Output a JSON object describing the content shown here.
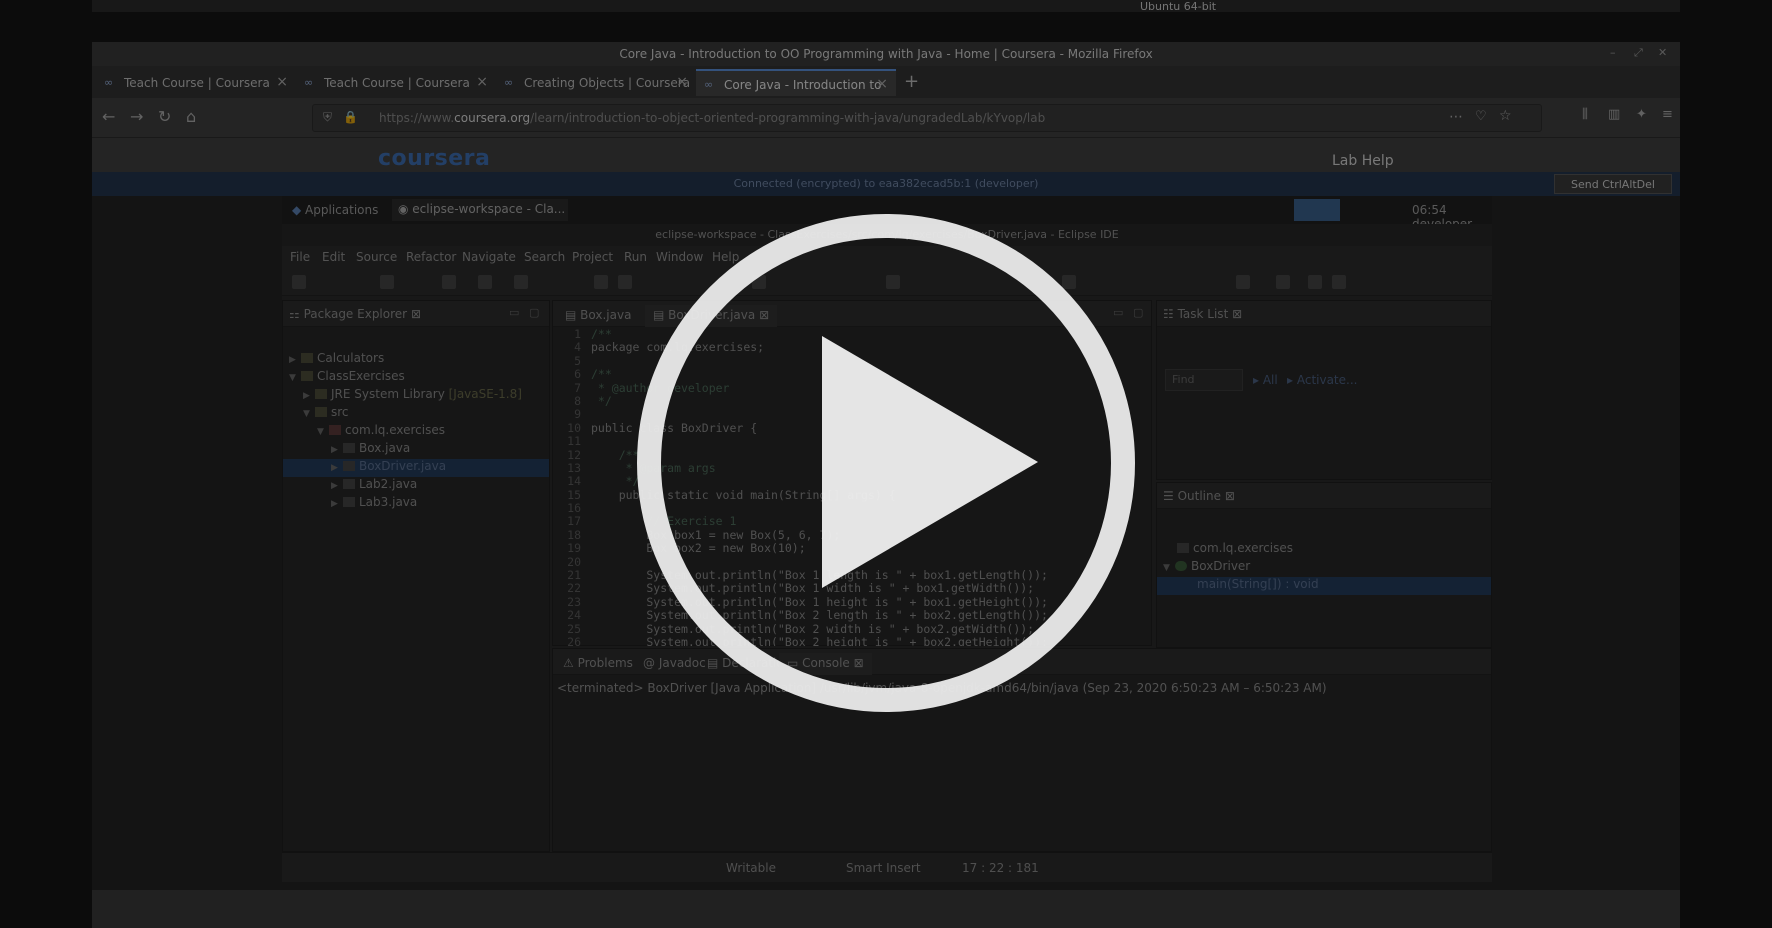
{
  "host": {
    "title": "Ubuntu 64-bit",
    "sub": "Ubuntu 64-bit"
  },
  "firefox": {
    "window_title": "Core Java - Introduction to OO Programming with Java - Home | Coursera - Mozilla Firefox",
    "tabs": [
      {
        "label": "Teach Course | Coursera"
      },
      {
        "label": "Teach Course | Coursera"
      },
      {
        "label": "Creating Objects | Coursera"
      },
      {
        "label": "Core Java - Introduction to"
      }
    ],
    "url_prefix": "https://www.",
    "url_domain": "coursera.org",
    "url_path": "/learn/introduction-to-object-oriented-programming-with-java/ungradedLab/kYvop/lab",
    "new_tab": "+"
  },
  "coursera": {
    "logo": "coursera",
    "lab_help": "Lab Help",
    "connection": "Connected (encrypted) to eaa382ecad5b:1 (developer)",
    "send_button": "Send CtrlAltDel"
  },
  "gnome": {
    "applications": "Applications",
    "task": "eclipse-workspace - Cla...",
    "time": "06:54 developer"
  },
  "eclipse": {
    "title": "eclipse-workspace - ClassExercises/src/com/lq/exercises/BoxDriver.java - Eclipse IDE",
    "menu": [
      "File",
      "Edit",
      "Source",
      "Refactor",
      "Navigate",
      "Search",
      "Project",
      "Run",
      "Window",
      "Help"
    ],
    "package_explorer": {
      "title": "Package Explorer",
      "items": [
        {
          "label": "Calculators",
          "suffix": ""
        },
        {
          "label": "ClassExercises",
          "suffix": ""
        },
        {
          "label": "JRE System Library",
          "suffix": " [JavaSE-1.8]"
        },
        {
          "label": "src",
          "suffix": ""
        },
        {
          "label": "com.lq.exercises",
          "suffix": ""
        },
        {
          "label": "Box.java",
          "suffix": ""
        },
        {
          "label": "BoxDriver.java",
          "suffix": ""
        },
        {
          "label": "Lab2.java",
          "suffix": ""
        },
        {
          "label": "Lab3.java",
          "suffix": ""
        }
      ]
    },
    "editor_tabs": [
      "Box.java",
      "BoxDriver.java"
    ],
    "code": [
      {
        "n": "1",
        "t": "/**"
      },
      {
        "n": "4",
        "t": "package com.lq.exercises;"
      },
      {
        "n": "5",
        "t": ""
      },
      {
        "n": "6",
        "t": "/**"
      },
      {
        "n": "7",
        "t": " * @author developer"
      },
      {
        "n": "8",
        "t": " */"
      },
      {
        "n": "9",
        "t": ""
      },
      {
        "n": "10",
        "t": "public class BoxDriver {"
      },
      {
        "n": "11",
        "t": ""
      },
      {
        "n": "12",
        "t": "    /**"
      },
      {
        "n": "13",
        "t": "     * @param args"
      },
      {
        "n": "14",
        "t": "     */"
      },
      {
        "n": "15",
        "t": "    public static void main(String[] args) {"
      },
      {
        "n": "16",
        "t": ""
      },
      {
        "n": "17",
        "t": "        // Exercise 1"
      },
      {
        "n": "18",
        "t": "        Box box1 = new Box(5, 6, 7);"
      },
      {
        "n": "19",
        "t": "        Box box2 = new Box(10);"
      },
      {
        "n": "20",
        "t": ""
      },
      {
        "n": "21",
        "t": "        System.out.println(\"Box 1 length is \" + box1.getLength());"
      },
      {
        "n": "22",
        "t": "        System.out.println(\"Box 1 width is \" + box1.getWidth());"
      },
      {
        "n": "23",
        "t": "        System.out.println(\"Box 1 height is \" + box1.getHeight());"
      },
      {
        "n": "24",
        "t": "        System.out.println(\"Box 2 length is \" + box2.getLength());"
      },
      {
        "n": "25",
        "t": "        System.out.println(\"Box 2 width is \" + box2.getWidth());"
      },
      {
        "n": "26",
        "t": "        System.out.println(\"Box 2 height is \" + box2.getHeight());"
      },
      {
        "n": "27",
        "t": ""
      }
    ],
    "task_list": {
      "title": "Task List",
      "find_placeholder": "Find",
      "all": "All",
      "activate": "Activate..."
    },
    "outline": {
      "title": "Outline",
      "items": [
        "com.lq.exercises",
        "BoxDriver",
        "main(String[]) : void"
      ]
    },
    "bottom_tabs": [
      "Problems",
      "Javadoc",
      "Declaration",
      "Console"
    ],
    "console_line": "<terminated> BoxDriver [Java Application] /usr/lib/jvm/java-8-openjdk-amd64/bin/java  (Sep 23, 2020 6:50:23 AM – 6:50:23 AM)",
    "status": {
      "writable": "Writable",
      "insert": "Smart Insert",
      "position": "17 : 22 : 181"
    }
  }
}
